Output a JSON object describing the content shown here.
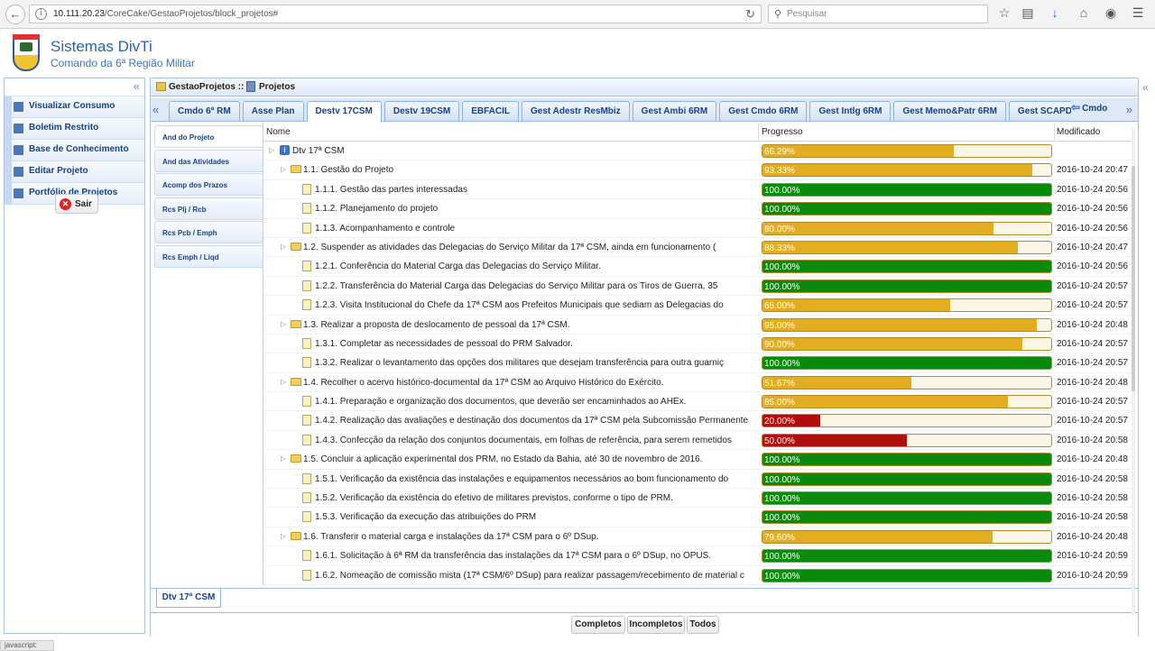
{
  "browser": {
    "url_host": "10.111.20.23",
    "url_path": "/CoreCake/GestaoProjetos/block_projetos#",
    "search_placeholder": "Pesquisar"
  },
  "header": {
    "title": "Sistemas DivTi",
    "subtitle": "Comando da 6ª Região Militar"
  },
  "sidebar": {
    "items": [
      {
        "label": "Visualizar Consumo"
      },
      {
        "label": "Boletim Restrito"
      },
      {
        "label": "Base de Conhecimento"
      },
      {
        "label": "Editar Projeto"
      },
      {
        "label": "Portfólio de Projetos"
      }
    ],
    "logout_label": "Sair"
  },
  "breadcrumb": {
    "root": "GestaoProjetos ::",
    "current": "Projetos"
  },
  "tabs": [
    "Cmdo 6ª RM",
    "Asse Plan",
    "Destv 17CSM",
    "Destv 19CSM",
    "EBFACIL",
    "Gest Adestr ResMbiz",
    "Gest Ambi 6RM",
    "Gest Cmdo 6RM",
    "Gest Intlg 6RM",
    "Gest Memo&Patr 6RM",
    "Gest SCAPD",
    "Gest"
  ],
  "active_tab": "Destv 17CSM",
  "cmdo_button": "Cmdo",
  "subnav": [
    "And do Projeto",
    "And das Atividades",
    "Acomp dos Prazos",
    "Rcs Plj / Rcb",
    "Rcs Pcb / Emph",
    "Rcs Emph / Liqd"
  ],
  "grid": {
    "columns": {
      "name": "Nome",
      "progress": "Progresso",
      "modified": "Modificado"
    },
    "rows": [
      {
        "level": 0,
        "type": "root",
        "name": "Dtv 17ª CSM",
        "pct": "66.29%",
        "value": 66.29,
        "color": "#e2ad1f",
        "date": ""
      },
      {
        "level": 1,
        "type": "folder",
        "name": "1.1. Gestão do Projeto",
        "pct": "93.33%",
        "value": 93.33,
        "color": "#e2ad1f",
        "date": "2016-10-24 20:47"
      },
      {
        "level": 2,
        "type": "doc",
        "name": "1.1.1. Gestão das partes interessadas",
        "pct": "100.00%",
        "value": 100,
        "color": "#0a8a0a",
        "date": "2016-10-24 20:56"
      },
      {
        "level": 2,
        "type": "doc",
        "name": "1.1.2. Planejamento do projeto",
        "pct": "100.00%",
        "value": 100,
        "color": "#0a8a0a",
        "date": "2016-10-24 20:56"
      },
      {
        "level": 2,
        "type": "doc",
        "name": "1.1.3. Acompanhamento e controle",
        "pct": "80.00%",
        "value": 80,
        "color": "#e2ad1f",
        "date": "2016-10-24 20:56"
      },
      {
        "level": 1,
        "type": "folder",
        "name": "1.2. Suspender as atividades das Delegacias do Serviço Militar da 17ª CSM, ainda em funcionamento (",
        "pct": "88.33%",
        "value": 88.33,
        "color": "#e2ad1f",
        "date": "2016-10-24 20:47"
      },
      {
        "level": 2,
        "type": "doc",
        "name": "1.2.1. Conferência do Material Carga das Delegacias do Serviço Militar.",
        "pct": "100.00%",
        "value": 100,
        "color": "#0a8a0a",
        "date": "2016-10-24 20:56"
      },
      {
        "level": 2,
        "type": "doc",
        "name": "1.2.2. Transferência do Material Carga das Delegacias do Serviço Militar para os Tiros de Guerra, 35",
        "pct": "100.00%",
        "value": 100,
        "color": "#0a8a0a",
        "date": "2016-10-24 20:57"
      },
      {
        "level": 2,
        "type": "doc",
        "name": "1.2.3. Visita Institucional do Chefe da 17ª CSM aos Prefeitos Municipais que sediam as Delegacias do",
        "pct": "65.00%",
        "value": 65,
        "color": "#e2ad1f",
        "date": "2016-10-24 20:57"
      },
      {
        "level": 1,
        "type": "folder",
        "name": "1.3. Realizar a proposta de deslocamento de pessoal da 17ª CSM.",
        "pct": "95.00%",
        "value": 95,
        "color": "#e2ad1f",
        "date": "2016-10-24 20:48"
      },
      {
        "level": 2,
        "type": "doc",
        "name": "1.3.1. Completar as necessidades de pessoal do PRM Salvador.",
        "pct": "90.00%",
        "value": 90,
        "color": "#e2ad1f",
        "date": "2016-10-24 20:57"
      },
      {
        "level": 2,
        "type": "doc",
        "name": "1.3.2. Realizar o levantamento das opções dos militares que desejam transferência para outra guarniç",
        "pct": "100.00%",
        "value": 100,
        "color": "#0a8a0a",
        "date": "2016-10-24 20:57"
      },
      {
        "level": 1,
        "type": "folder",
        "name": "1.4. Recolher o acervo histórico-documental da 17ª CSM ao Arquivo Histórico do Exército.",
        "pct": "51.67%",
        "value": 51.67,
        "color": "#e2ad1f",
        "date": "2016-10-24 20:48"
      },
      {
        "level": 2,
        "type": "doc",
        "name": "1.4.1. Preparação e organização dos documentos, que deverão ser encaminhados ao AHEx.",
        "pct": "85.00%",
        "value": 85,
        "color": "#e2ad1f",
        "date": "2016-10-24 20:57"
      },
      {
        "level": 2,
        "type": "doc",
        "name": "1.4.2. Realização das avaliações e destinação dos documentos da 17ª CSM pela Subcomissão Permanente",
        "pct": "20.00%",
        "value": 20,
        "color": "#b00d0d",
        "date": "2016-10-24 20:57"
      },
      {
        "level": 2,
        "type": "doc",
        "name": "1.4.3. Confecção da relação dos conjuntos documentais, em folhas de referência, para serem remetidos",
        "pct": "50.00%",
        "value": 50,
        "color": "#b00d0d",
        "date": "2016-10-24 20:58"
      },
      {
        "level": 1,
        "type": "folder",
        "name": "1.5. Concluir a aplicação experimental dos PRM, no Estado da Bahia, até 30 de novembro de 2016.",
        "pct": "100.00%",
        "value": 100,
        "color": "#0a8a0a",
        "date": "2016-10-24 20:48"
      },
      {
        "level": 2,
        "type": "doc",
        "name": "1.5.1. Verificação da existência das instalações e equipamentos necessários ao bom funcionamento do",
        "pct": "100.00%",
        "value": 100,
        "color": "#0a8a0a",
        "date": "2016-10-24 20:58"
      },
      {
        "level": 2,
        "type": "doc",
        "name": "1.5.2. Verificação da existência do efetivo de militares previstos, conforme o tipo de PRM.",
        "pct": "100.00%",
        "value": 100,
        "color": "#0a8a0a",
        "date": "2016-10-24 20:58"
      },
      {
        "level": 2,
        "type": "doc",
        "name": "1.5.3. Verificação da execução das atribuições do PRM",
        "pct": "100.00%",
        "value": 100,
        "color": "#0a8a0a",
        "date": "2016-10-24 20:58"
      },
      {
        "level": 1,
        "type": "folder",
        "name": "1.6. Transferir o material carga e instalações da 17ª CSM para o 6º DSup.",
        "pct": "79.60%",
        "value": 79.6,
        "color": "#e2ad1f",
        "date": "2016-10-24 20:48"
      },
      {
        "level": 2,
        "type": "doc",
        "name": "1.6.1. Solicitação à 6ª RM da transferência das instalações da 17ª CSM para o 6º DSup, no OPUS.",
        "pct": "100.00%",
        "value": 100,
        "color": "#0a8a0a",
        "date": "2016-10-24 20:59"
      },
      {
        "level": 2,
        "type": "doc",
        "name": "1.6.2. Nomeação de comissão mista (17ª CSM/6º DSup) para realizar passagem/recebimento de material c",
        "pct": "100.00%",
        "value": 100,
        "color": "#0a8a0a",
        "date": "2016-10-24 20:59"
      }
    ]
  },
  "bottom_tab": "Dtv 17ª CSM",
  "footer_buttons": [
    "Completos",
    "Incompletos",
    "Todos"
  ],
  "status_text": "javascript:"
}
